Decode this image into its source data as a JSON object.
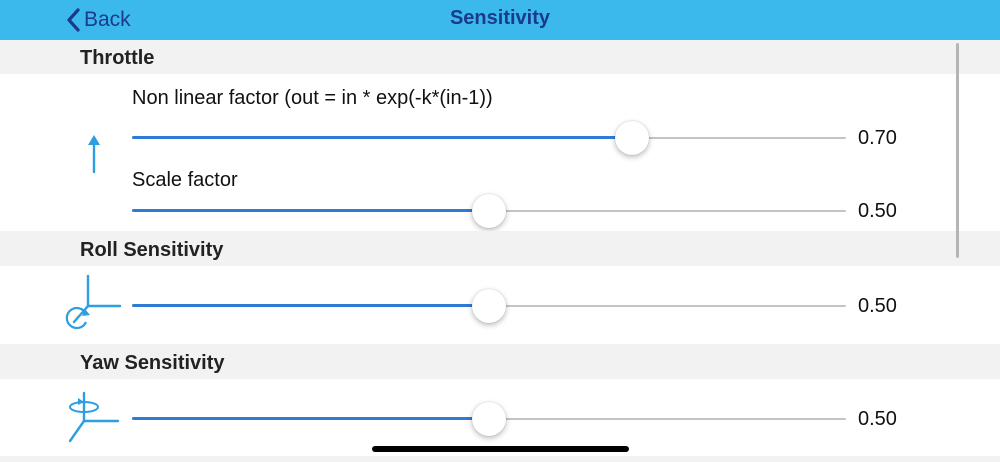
{
  "navbar": {
    "back_label": "Back",
    "title": "Sensitivity",
    "background": "#3cb9ec",
    "text_color": "#1b3a8c"
  },
  "accent_color": "#2f7bd4",
  "icon_color": "#2d9ee0",
  "sections": {
    "throttle": {
      "header": "Throttle",
      "icon": "throttle-arrow-icon",
      "nonlinear": {
        "label": "Non linear factor (out = in * exp(-k*(in-1))",
        "value": 0.7,
        "value_text": "0.70"
      },
      "scale": {
        "label": "Scale factor",
        "value": 0.5,
        "value_text": "0.50"
      }
    },
    "roll": {
      "header": "Roll Sensitivity",
      "icon": "roll-axis-icon",
      "slider": {
        "value": 0.5,
        "value_text": "0.50"
      }
    },
    "yaw": {
      "header": "Yaw Sensitivity",
      "icon": "yaw-axis-icon",
      "slider": {
        "value": 0.5,
        "value_text": "0.50"
      }
    }
  }
}
